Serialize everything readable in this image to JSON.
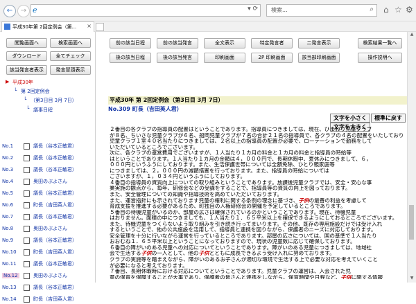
{
  "browser": {
    "url": "",
    "search_placeholder": "検索...",
    "tab_title": "平成30年第 2回定例会（第...",
    "back_glyph": "←",
    "forward_glyph": "→"
  },
  "left_buttons": {
    "prev_hit": "閲覧画面へ",
    "search_screen": "検索画面へ",
    "download": "ダウンロード",
    "check_all": "全てチェック",
    "show_speakers": "該当発言者表示",
    "show_speeches": "発言冒頭表示"
  },
  "tree": {
    "root": "平成30年",
    "session": "第 2回定例会",
    "date": "（第3日目 3月 7日）",
    "top_item": "議事日程"
  },
  "speakers": [
    {
      "no": "No.1",
      "name": "議長（谷本正敏君）"
    },
    {
      "no": "No.2",
      "name": "議長（谷本正敏君）"
    },
    {
      "no": "No.3",
      "name": "議長（谷本正敏君）"
    },
    {
      "no": "No.4",
      "name": "奥田のぶよさん"
    },
    {
      "no": "No.5",
      "name": "議長（谷本正敏君）"
    },
    {
      "no": "No.6",
      "name": "町長（吉田英人君）"
    },
    {
      "no": "No.7",
      "name": "議長（谷本正敏君）"
    },
    {
      "no": "No.8",
      "name": "奥田のぶよさん"
    },
    {
      "no": "No.9",
      "name": "議長（谷本正敏君）"
    },
    {
      "no": "No.10",
      "name": "町長（吉田英人君）"
    },
    {
      "no": "No.11",
      "name": "議長（谷本正敏君）"
    },
    {
      "no": "No.12",
      "name": "奥田のぶよさん"
    },
    {
      "no": "No.13",
      "name": "議長（谷本正敏君）"
    },
    {
      "no": "No.14",
      "name": "町長（吉田英人君）"
    }
  ],
  "selected_index": 11,
  "toolbar": {
    "prev_day": "前の該当日程",
    "prev_speech": "前の該当発言",
    "full_text": "全文表示",
    "specific_speaker": "特定発言者",
    "two_speeches": "二発言表示",
    "results_list": "検索結果一覧へ",
    "next_day": "後の該当日程",
    "next_speech": "後の該当発言",
    "print": "印刷画面",
    "print_2p": "2P 印刷画面",
    "print_hits": "該当部印刷画面",
    "help": "操作説明へ"
  },
  "document": {
    "session_title": "平成30年 第 2回定例会（第3日目 3月 7日）",
    "speaker_line": "No.309 町長（吉田英人君）",
    "font_smaller": "文字を小さく",
    "font_standard": "標準に戻す",
    "font_larger": "文字を大きく",
    "paragraphs": [
      "２番目の各クラブの指導員の配置はということであります。指導員につきましては、現在、ひまわり児童クラブ",
      "が８名、ちいさな児童クラブが６名、船岡児童クラブが７名の合計２１名の指導員で、各クラブの４名の配置をいたしております。",
      "児童クラブ１室４０名当たりにつきましては、２名以上の指導員の配置が必要で、ローテーションで勤務をして",
      "いただいているところでございます。",
      "次に、各クラブの運営費用でございますが、１人当たり１カ月の料金と１カ月の料金と指導員の時給等",
      "はということであります。１人当たり１カ月の金額は４，０００円で、長期休暇中、夏休みにつきまして、６，",
      "０００円というふうにしております。また、生活保護世帯については全額免除、ひとり親家庭等",
      "につきましては、２，０００円の減額措置を行っております。また、指導員の時給については",
      "ございますが、１，０３４円というふうにしております。",
      "４番目の指導員の資質向上についての取り組みということであります。放課後児童クラブでは、安全・安心な事",
      "業実施の観点から、毎年、研修会などの受講をすることで、指導員等の資質の向上を図っております。",
      "また、安全管理についての知識や指導技術を高めていただいております。",
      "また、運営指針にも示されております児童の権利に関する条例の理念に基づき、子供の最善の利益を考慮して",
      "育成支援を推進する必要があるため、町独自の人権研修会の開催を予定しているところであります。",
      "５番目の待機児童がいるのか、部屋の広さは確保されているのかということであります。現在、待機児童",
      "はおりません。面積の中につきましても、１人当たり１．６５平米以上を確保できるようにしておるところでございます。",
      "また、待機児童をつくらないよう取り組みを引き続き行ってまいります。その他、既存の専用施設だけでは受け入れ",
      "するということで、他の公共施設を活用して、指導員と連携を図りながら、保護者のニーズに対応しております。",
      "安全管理を十分に行いながら運営を行っているところであります。部屋の広さについては、国の基準で１人当たり",
      "おおむね１．６５平米以上ということになっておりますので、現状の児童数に応じて確保しております。",
      "６番目の障がいのある児童への対応についてということであります。障がいのある児童につきましては、地域社",
      "会で生活する子供の一人として、他の子供とともに成長できるよう受け入れに努めております。",
      "クラブの実施等を踏まえながら、障がいのあるお子さんが適切な環境で生活する上で必要な対応を考えていくこと",
      "が必要になると考えております。",
      "７番目、長期休暇時における対応についてということであります。児童クラブの運営は、入会された児",
      "童の保育を保障することが大事であり、保護者の皆さんと連携をしながら、保育時間や日程など、子供に関する情報",
      "等を家庭と放課後児童クラブで共有することにより、安心して子供を預けることができるよう、保護者会を開催",
      "しているところであります。",
      "保護者会では、年度始めの夏休み等の長期休暇の前に開催され、各クラブでの過ごし方やルール、イベント、行",
      "事等について話し合われ、各児童クラブの実態にあわせた取り組みを行っていただいているところであります。",
      "最初の答弁といたします。"
    ]
  }
}
